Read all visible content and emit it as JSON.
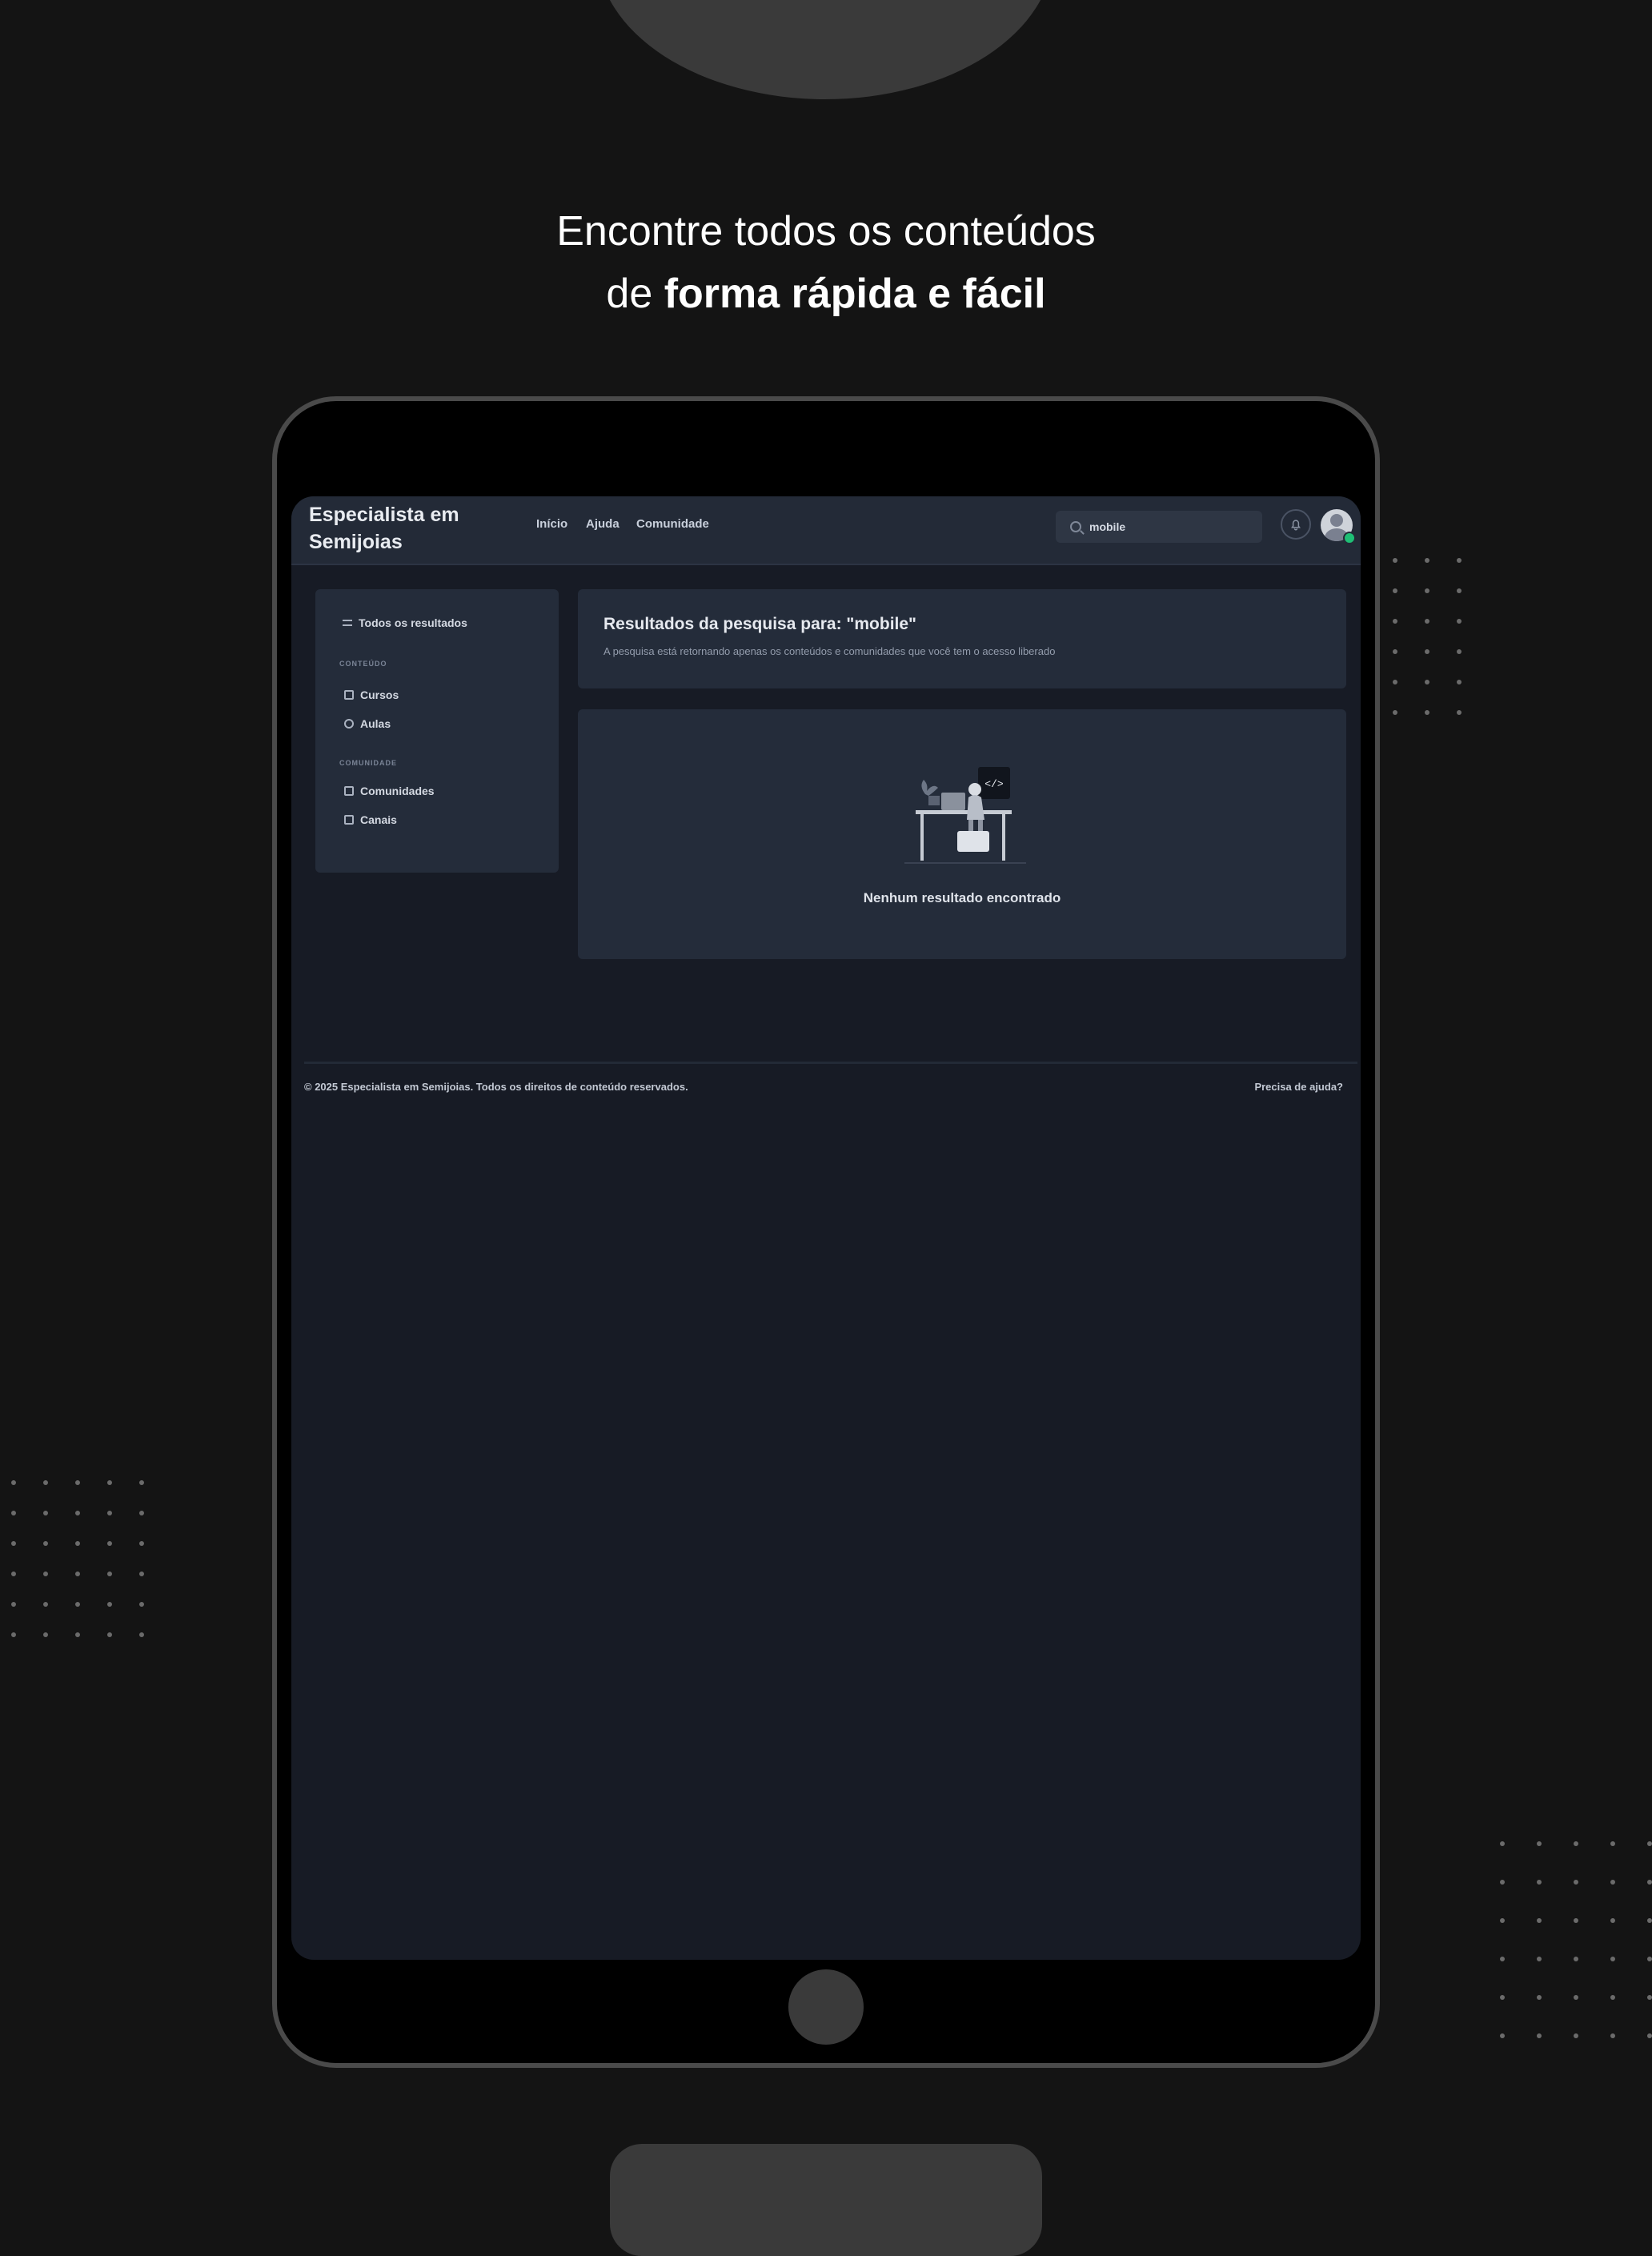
{
  "headline": {
    "line1": "Encontre todos os conteúdos",
    "line2_prefix": "de",
    "line2_bold": "forma rápida e fácil"
  },
  "app": {
    "brand_line1": "Especialista em",
    "brand_line2": "Semijoias",
    "nav": [
      "Início",
      "Ajuda",
      "Comunidade"
    ],
    "search": {
      "value": "mobile",
      "icon": "search-icon"
    },
    "notifications_icon": "bell-icon",
    "avatar_icon": "user-avatar",
    "status_color": "#1fbf75"
  },
  "sidebar": {
    "all_results": "Todos os resultados",
    "section_content": "CONTEÚDO",
    "content_items": [
      "Cursos",
      "Aulas"
    ],
    "section_community": "COMUNIDADE",
    "community_items": [
      "Comunidades",
      "Canais"
    ]
  },
  "results": {
    "title": "Resultados da pesquisa para: \"mobile\"",
    "subtitle": "A pesquisa está retornando apenas os conteúdos e comunidades que você tem o acesso liberado",
    "empty_message": "Nenhum resultado encontrado",
    "illustration": "developer-at-desk-illustration",
    "illustration_label": "</>"
  },
  "footer": {
    "copyright": "© 2025 Especialista em Semijoias. Todos os direitos de conteúdo reservados.",
    "help_link": "Precisa de ajuda?"
  },
  "colors": {
    "page_bg": "#141414",
    "screen_bg": "#171b25",
    "card_bg": "#242c3a",
    "topbar_bg": "#232a37"
  }
}
